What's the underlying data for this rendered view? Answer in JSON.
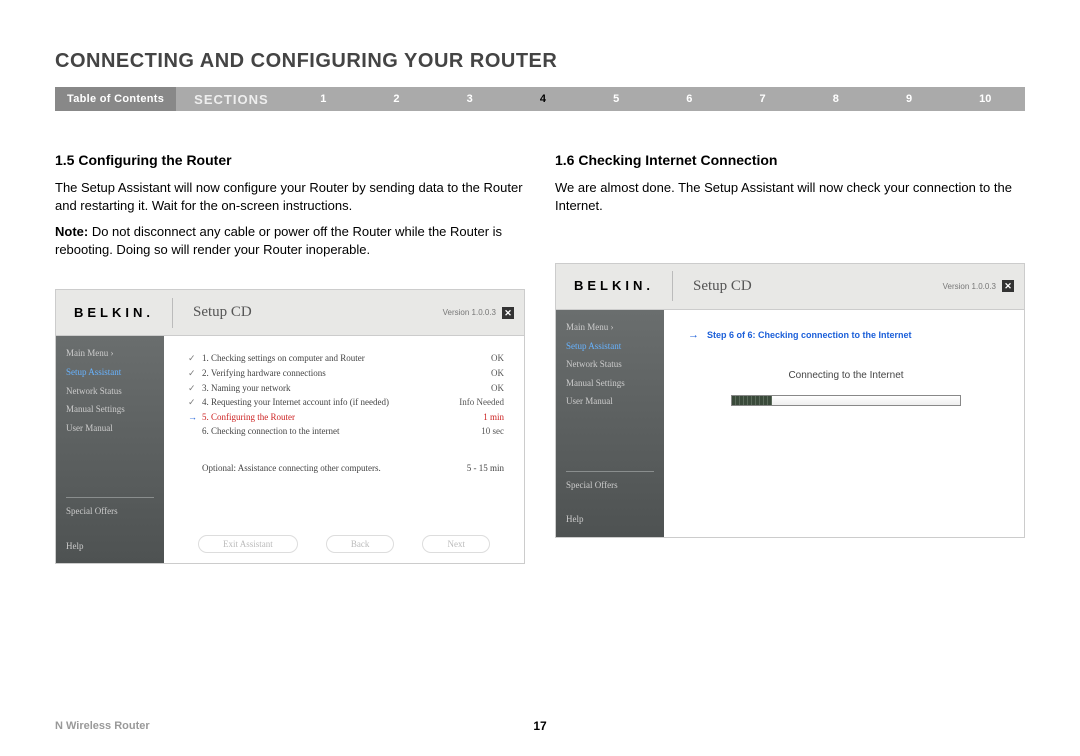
{
  "page": {
    "title": "CONNECTING AND CONFIGURING YOUR ROUTER",
    "product": "N Wireless Router",
    "page_number": "17"
  },
  "nav": {
    "toc_label": "Table of Contents",
    "sections_label": "SECTIONS",
    "numbers": [
      "1",
      "2",
      "3",
      "4",
      "5",
      "6",
      "7",
      "8",
      "9",
      "10"
    ],
    "active": "4"
  },
  "left_col": {
    "heading": "1.5 Configuring the Router",
    "para1": "The Setup Assistant will now configure your Router by sending data to the Router and restarting it. Wait for the on-screen instructions.",
    "note_label": "Note:",
    "note_text": " Do not disconnect any cable or power off the Router while the Router is rebooting. Doing so will render your Router inoperable."
  },
  "right_col": {
    "heading": "1.6 Checking Internet Connection",
    "para1": "We are almost done. The Setup Assistant will now check your connection to the Internet."
  },
  "app_common": {
    "brand": "BELKIN.",
    "title": "Setup CD",
    "version": "Version 1.0.0.3",
    "close": "✕"
  },
  "sidebar": {
    "main_menu": "Main Menu  ›",
    "setup_assistant": "Setup Assistant",
    "network_status": "Network Status",
    "manual_settings": "Manual Settings",
    "user_manual": "User Manual",
    "special_offers": "Special Offers",
    "help": "Help"
  },
  "left_app": {
    "steps": [
      {
        "icon": "check",
        "label": "1. Checking settings on computer and Router",
        "status": "OK"
      },
      {
        "icon": "check",
        "label": "2. Verifying hardware connections",
        "status": "OK"
      },
      {
        "icon": "check",
        "label": "3. Naming your network",
        "status": "OK"
      },
      {
        "icon": "check",
        "label": "4. Requesting your Internet account info (if needed)",
        "status": "Info Needed"
      },
      {
        "icon": "arrow",
        "label": "5. Configuring the Router",
        "status": "1 min",
        "current": true
      },
      {
        "icon": "",
        "label": "6. Checking connection to the internet",
        "status": "10 sec"
      }
    ],
    "optional_label": "Optional: Assistance connecting other computers.",
    "optional_time": "5 - 15 min",
    "buttons": {
      "exit": "Exit Assistant",
      "back": "Back",
      "next": "Next"
    }
  },
  "right_app": {
    "step_line": "Step 6 of 6: Checking connection to the Internet",
    "connecting": "Connecting to the Internet"
  }
}
